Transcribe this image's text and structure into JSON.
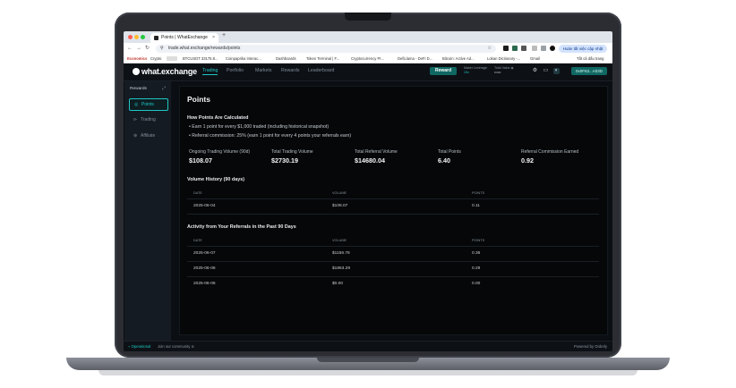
{
  "browser": {
    "tab_title": "Points | WhatExchange",
    "tab_close": "×",
    "new_tab": "+",
    "url": "trade.what.exchange/rewards/points",
    "update_label": "Hoàn tất việc cập nhật",
    "bookmarks": [
      "Economics",
      "Crypto",
      "BTCUSDT 33175.8...",
      "Coinpaprika Interac...",
      "Dashboards",
      "Token Terminal | F...",
      "Cryptocurrency Pr...",
      "DefiLlama - DeFi D...",
      "Bitcoin: Active Ad...",
      "Lokan Dictionary -...",
      "Gmail"
    ],
    "bookmarks_all": "Tất cả dấu trang"
  },
  "app": {
    "logo": "what.exchange",
    "nav": [
      "Trading",
      "Portfolio",
      "Markets",
      "Rewards",
      "Leaderboard"
    ],
    "reward_button": "Reward",
    "meta": {
      "label1": "Maker Leverage",
      "value1": "10x",
      "label2": "Total Value ◉",
      "value2": "••••••"
    },
    "account_button": "0x0F63...A03D"
  },
  "sidebar": {
    "title": "Rewards",
    "collapse_icon": "⤢",
    "items": [
      {
        "label": "Points",
        "icon": "◎"
      },
      {
        "label": "Trading",
        "icon": "⊳"
      },
      {
        "label": "Affiliate",
        "icon": "⊕"
      }
    ]
  },
  "main": {
    "title": "Points",
    "how_title": "How Points Are Calculated",
    "bullets": [
      "• Earn 1 point for every $1,000 traded (including historical snapshot)",
      "• Referral commission: 25% (earn 1 point for every 4 points your referrals earn)"
    ],
    "stats": [
      {
        "label": "Ongoing Trading Volume (90d)",
        "value": "$108.07"
      },
      {
        "label": "Total Trading Volume",
        "value": "$2730.19"
      },
      {
        "label": "Total Referral Volume",
        "value": "$14680.04"
      },
      {
        "label": "Total Points",
        "value": "6.40"
      },
      {
        "label": "Referral Commission Earned",
        "value": "0.92"
      }
    ],
    "volume_history": {
      "title": "Volume History (90 days)",
      "columns": [
        "DATE",
        "VOLUME",
        "POINTS"
      ],
      "rows": [
        [
          "2025-06-04",
          "$108.07",
          "0.11"
        ]
      ]
    },
    "referral_activity": {
      "title": "Activity from Your Referrals in the Past 90 Days",
      "columns": [
        "DATE",
        "VOLUME",
        "POINTS"
      ],
      "rows": [
        [
          "2025-06-07",
          "$1156.76",
          "0.36"
        ],
        [
          "2025-06-06",
          "$1863.29",
          "0.29"
        ],
        [
          "2025-06-05",
          "$0.00",
          "0.00"
        ]
      ]
    }
  },
  "footer": {
    "status": "⌁ Operational",
    "community": "Join our community",
    "powered": "Powered by Orderly"
  }
}
